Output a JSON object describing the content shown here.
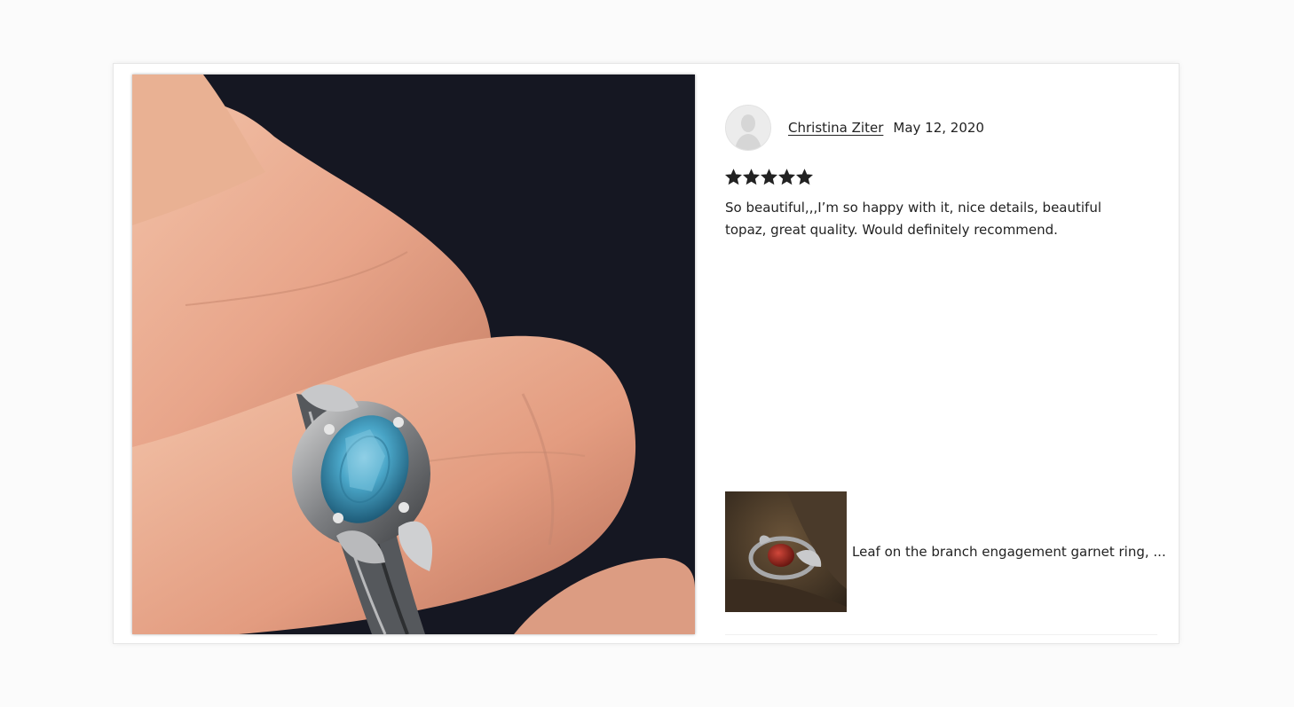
{
  "review": {
    "reviewer_name": "Christina Ziter",
    "date": "May 12, 2020",
    "rating": 5,
    "rating_max": 5,
    "text": "So beautiful,,,I’m so happy with it, nice details, beautiful topaz, great quality. Would definitely recommend."
  },
  "product": {
    "title": "Leaf on the branch engagement garnet ring, ..."
  },
  "colors": {
    "star": "#222222",
    "text": "#222222",
    "photo_background": "#151722",
    "topaz": "#3f95b6",
    "garnet": "#7a1a12"
  },
  "icons": {
    "avatar": "default-avatar-icon",
    "star": "star-icon"
  }
}
